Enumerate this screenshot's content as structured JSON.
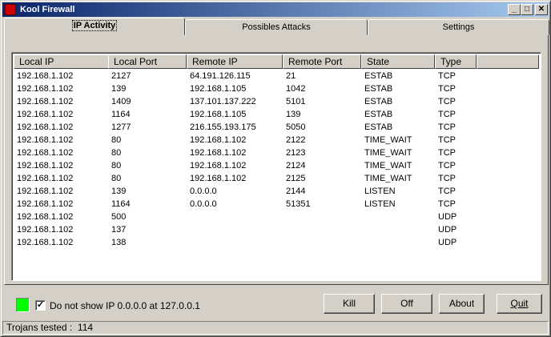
{
  "window": {
    "title": "Kool Firewall",
    "minimize": "_",
    "maximize": "□",
    "close": "✕"
  },
  "tabs": [
    {
      "label": "IP Activity",
      "selected": true
    },
    {
      "label": "Possibles Attacks"
    },
    {
      "label": "Settings"
    }
  ],
  "table": {
    "columns": [
      "Local IP",
      "Local Port",
      "Remote IP",
      "Remote Port",
      "State",
      "Type"
    ],
    "rows": [
      [
        "192.168.1.102",
        "2127",
        "64.191.126.115",
        "21",
        "ESTAB",
        "TCP"
      ],
      [
        "192.168.1.102",
        "139",
        "192.168.1.105",
        "1042",
        "ESTAB",
        "TCP"
      ],
      [
        "192.168.1.102",
        "1409",
        "137.101.137.222",
        "5101",
        "ESTAB",
        "TCP"
      ],
      [
        "192.168.1.102",
        "1164",
        "192.168.1.105",
        "139",
        "ESTAB",
        "TCP"
      ],
      [
        "192.168.1.102",
        "1277",
        "216.155.193.175",
        "5050",
        "ESTAB",
        "TCP"
      ],
      [
        "192.168.1.102",
        "80",
        "192.168.1.102",
        "2122",
        "TIME_WAIT",
        "TCP"
      ],
      [
        "192.168.1.102",
        "80",
        "192.168.1.102",
        "2123",
        "TIME_WAIT",
        "TCP"
      ],
      [
        "192.168.1.102",
        "80",
        "192.168.1.102",
        "2124",
        "TIME_WAIT",
        "TCP"
      ],
      [
        "192.168.1.102",
        "80",
        "192.168.1.102",
        "2125",
        "TIME_WAIT",
        "TCP"
      ],
      [
        "192.168.1.102",
        "139",
        "0.0.0.0",
        "2144",
        "LISTEN",
        "TCP"
      ],
      [
        "192.168.1.102",
        "1164",
        "0.0.0.0",
        "51351",
        "LISTEN",
        "TCP"
      ],
      [
        "192.168.1.102",
        "500",
        "",
        "",
        "",
        "UDP"
      ],
      [
        "192.168.1.102",
        "137",
        "",
        "",
        "",
        "UDP"
      ],
      [
        "192.168.1.102",
        "138",
        "",
        "",
        "",
        "UDP"
      ]
    ]
  },
  "status_indicator_color": "#00ff00",
  "checkbox": {
    "label": "Do not show IP 0.0.0.0 at 127.0.0.1",
    "checked": true
  },
  "buttons": {
    "kill": "Kill",
    "off": "Off",
    "about": "About",
    "quit": "Quit"
  },
  "statusbar": {
    "text": "Trojans tested :  114"
  }
}
